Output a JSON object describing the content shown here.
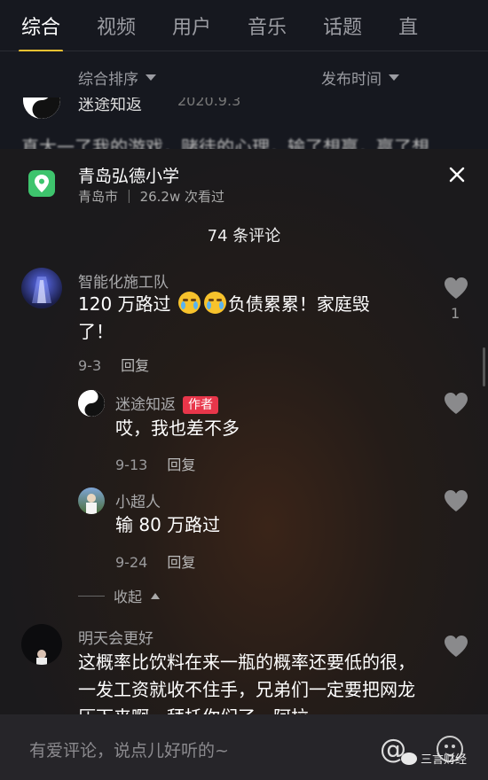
{
  "tabs": [
    "综合",
    "视频",
    "用户",
    "音乐",
    "话题",
    "直"
  ],
  "sort": {
    "left": "综合排序",
    "right": "发布时间"
  },
  "background": {
    "name": "迷途知返",
    "date": "2020.9.3",
    "line": "真大一了我的游戏，赌徒的心理，输了想赢，赢了想"
  },
  "location": {
    "name": "青岛弘德小学",
    "city": "青岛市",
    "views": "26.2w 次看过"
  },
  "comment_count": "74 条评论",
  "comments": [
    {
      "user": "智能化施工队",
      "text_before": "120 万路过",
      "text_after": "负债累累！家庭毁了！",
      "date": "9-3",
      "reply": "回复",
      "likes": "1"
    },
    {
      "user": "迷途知返",
      "badge": "作者",
      "text": "哎，我也差不多",
      "date": "9-13",
      "reply": "回复"
    },
    {
      "user": "小超人",
      "text": "输 80 万路过",
      "date": "9-24",
      "reply": "回复"
    },
    {
      "user": "明天会更好",
      "text": "这概率比饮料在来一瓶的概率还要低的很，一发工资就收不住手，兄弟们一定要把网龙压下来啊，拜托你们了，阿拉"
    }
  ],
  "collapse_label": "收起",
  "input": {
    "placeholder": "有爱评论，说点儿好听的~",
    "at": "@"
  },
  "watermark": "三言财经",
  "colors": {
    "accent": "#f2c232",
    "author_badge": "#e8364a",
    "location_icon": "#3ec46d"
  }
}
